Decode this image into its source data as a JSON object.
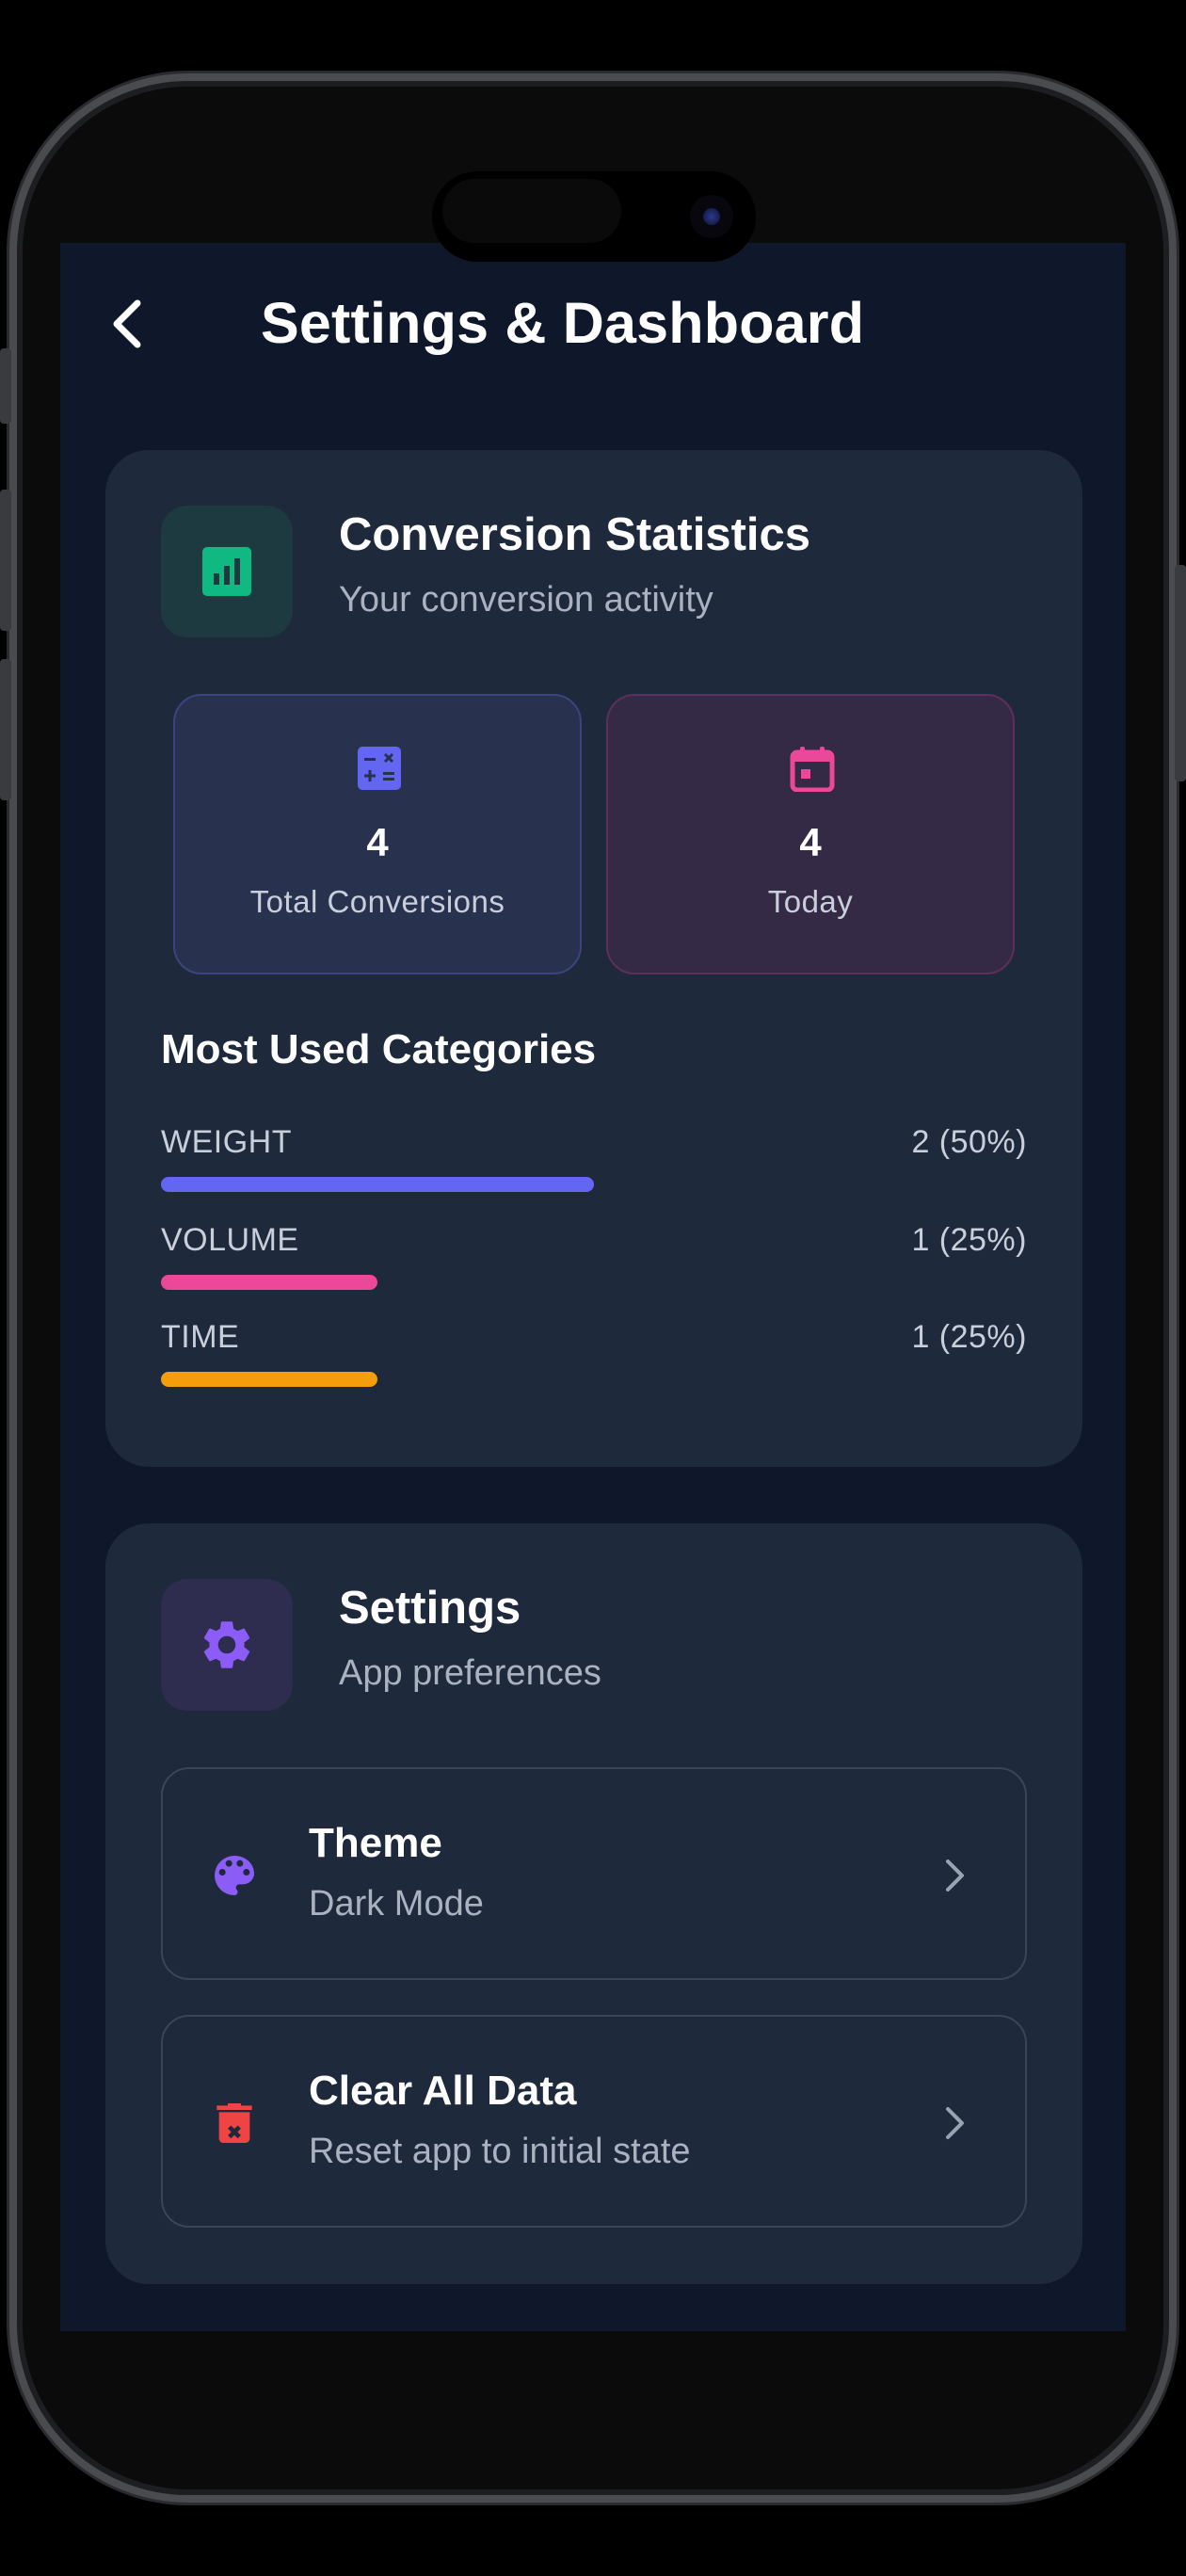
{
  "header": {
    "title": "Settings & Dashboard"
  },
  "stats_card": {
    "title": "Conversion Statistics",
    "subtitle": "Your conversion activity",
    "boxes": [
      {
        "value": "4",
        "label": "Total Conversions",
        "icon": "calculator-icon",
        "accent": "#6366f1"
      },
      {
        "value": "4",
        "label": "Today",
        "icon": "calendar-icon",
        "accent": "#ec4899"
      }
    ],
    "categories_heading": "Most Used Categories",
    "categories": [
      {
        "name": "WEIGHT",
        "value": "2 (50%)",
        "share": 0.5,
        "color": "#6366f1"
      },
      {
        "name": "VOLUME",
        "value": "1 (25%)",
        "share": 0.25,
        "color": "#ec4899"
      },
      {
        "name": "TIME",
        "value": "1 (25%)",
        "share": 0.25,
        "color": "#f59e0b"
      }
    ]
  },
  "settings_card": {
    "title": "Settings",
    "subtitle": "App preferences",
    "items": [
      {
        "title": "Theme",
        "subtitle": "Dark Mode",
        "icon": "palette-icon",
        "color": "#8b5cf6"
      },
      {
        "title": "Clear All Data",
        "subtitle": "Reset app to initial state",
        "icon": "trash-icon",
        "color": "#ef4444"
      }
    ]
  },
  "colors": {
    "background": "#0f172a",
    "card": "#1e293b",
    "stats_icon": "#10b981",
    "settings_icon": "#8b5cf6"
  }
}
